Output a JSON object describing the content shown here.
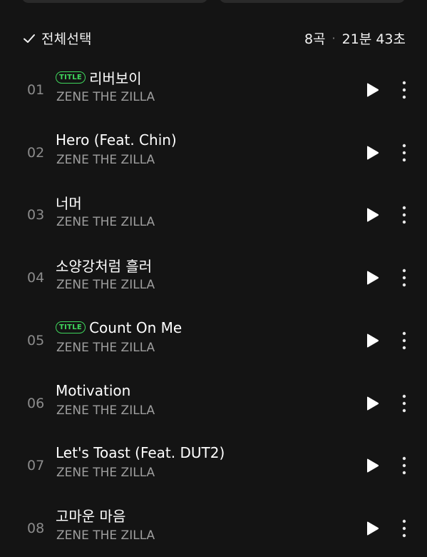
{
  "header": {
    "select_all_label": "전체선택",
    "track_count": "8곡",
    "separator": "·",
    "total_duration": "21분 43초"
  },
  "badge_label": "TITLE",
  "tracks": [
    {
      "number": "01",
      "title": "리버보이",
      "artist": "ZENE THE ZILLA",
      "is_title": true
    },
    {
      "number": "02",
      "title": "Hero (Feat. Chin)",
      "artist": "ZENE THE ZILLA",
      "is_title": false
    },
    {
      "number": "03",
      "title": "너머",
      "artist": "ZENE THE ZILLA",
      "is_title": false
    },
    {
      "number": "04",
      "title": "소양강처럼 흘러",
      "artist": "ZENE THE ZILLA",
      "is_title": false
    },
    {
      "number": "05",
      "title": "Count On Me",
      "artist": "ZENE THE ZILLA",
      "is_title": true
    },
    {
      "number": "06",
      "title": "Motivation",
      "artist": "ZENE THE ZILLA",
      "is_title": false
    },
    {
      "number": "07",
      "title": "Let's Toast (Feat. DUT2)",
      "artist": "ZENE THE ZILLA",
      "is_title": false
    },
    {
      "number": "08",
      "title": "고마운 마음",
      "artist": "ZENE THE ZILLA",
      "is_title": false
    }
  ],
  "icons": {
    "check": "check-icon",
    "play": "play-icon",
    "more": "more-vertical-icon"
  },
  "colors": {
    "background": "#141414",
    "accent_green": "#3fd65c",
    "text_primary": "#ffffff",
    "text_secondary": "#9e9e9e"
  }
}
